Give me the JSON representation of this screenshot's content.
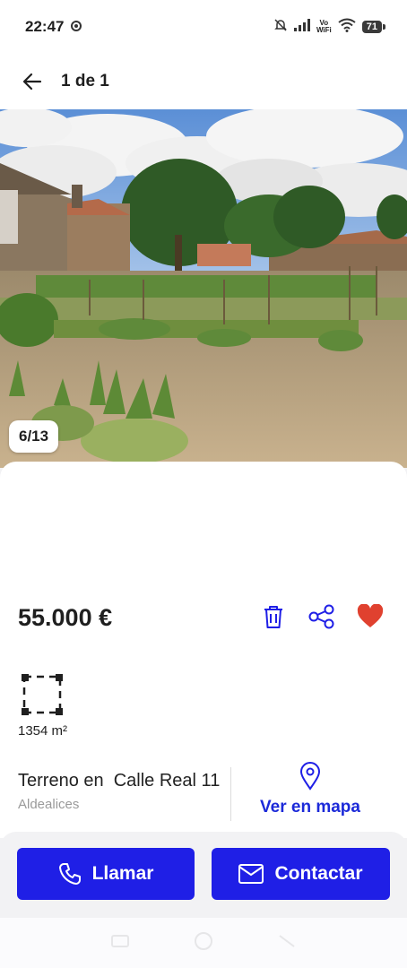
{
  "status_bar": {
    "time": "22:47",
    "vowifi_top": "Vo",
    "vowifi_bottom": "WiFi",
    "battery": "71"
  },
  "nav": {
    "pager": "1 de 1"
  },
  "photo": {
    "counter": "6/13"
  },
  "listing": {
    "price": "55.000 €",
    "area": "1354 m²",
    "address": "Terreno en  Calle Real 11",
    "locality": "Aldealices",
    "map_label": "Ver en mapa"
  },
  "actions": {
    "call": "Llamar",
    "contact": "Contactar"
  },
  "colors": {
    "accent": "#1f1fe6",
    "favorite": "#e0412f",
    "link": "#1c2ad9"
  }
}
